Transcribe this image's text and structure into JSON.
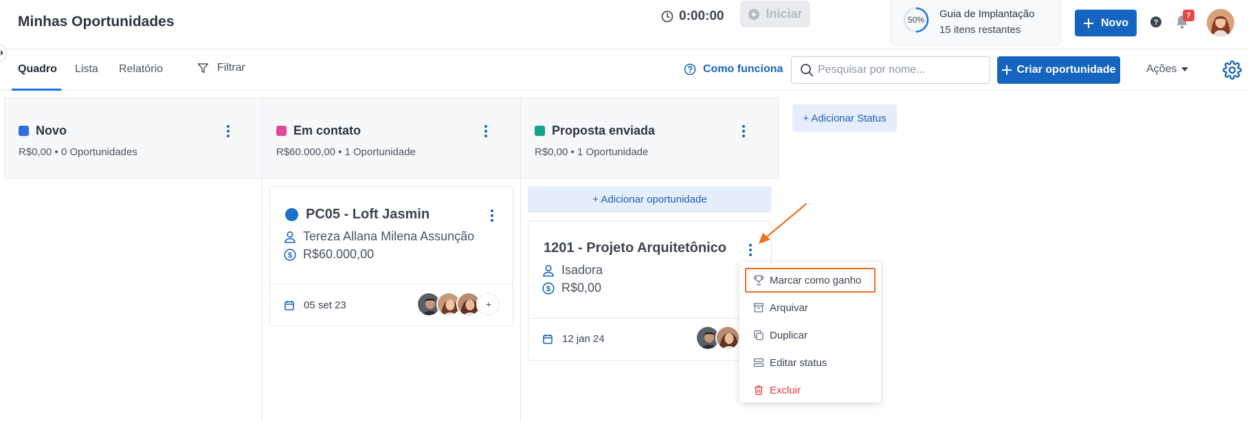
{
  "header": {
    "title": "Minhas Oportunidades",
    "timer": "0:00:00",
    "start_label": "Iniciar",
    "guide": {
      "progress_label": "50%",
      "progress": 0.5,
      "title": "Guia de Implantação",
      "subtitle": "15 itens restantes"
    },
    "new_label": "Novo",
    "notifications_count": "7"
  },
  "tabs": [
    "Quadro",
    "Lista",
    "Relatório"
  ],
  "toolbar": {
    "filter_label": "Filtrar",
    "how_label": "Como funciona",
    "search_placeholder": "Pesquisar por nome...",
    "create_label": "Criar oportunidade",
    "actions_label": "Ações"
  },
  "columns": [
    {
      "title": "Novo",
      "color": "#2f6fdb",
      "summary": "R$0,00 • 0 Oportunidades"
    },
    {
      "title": "Em contato",
      "color": "#e5489b",
      "summary": "R$60.000,00 • 1 Oportunidade"
    },
    {
      "title": "Proposta enviada",
      "color": "#14a38b",
      "summary": "R$0,00 • 1 Oportunidade"
    }
  ],
  "add_status_label": "+ Adicionar Status",
  "add_opportunity_label": "+ Adicionar oportunidade",
  "cards": [
    {
      "title": "PC05 - Loft Jasmin",
      "person": "Tereza Allana Milena Assunção",
      "value": "R$60.000,00",
      "date": "05 set 23",
      "more_label": "+"
    },
    {
      "title": "1201 - Projeto Arquitetônico",
      "person": "Isadora",
      "value": "R$0,00",
      "date": "12 jan 24"
    }
  ],
  "menu": [
    {
      "label": "Marcar como ganho",
      "icon": "trophy-icon"
    },
    {
      "label": "Arquivar",
      "icon": "archive-icon"
    },
    {
      "label": "Duplicar",
      "icon": "copy-icon"
    },
    {
      "label": "Editar status",
      "icon": "status-icon"
    },
    {
      "label": "Excluir",
      "icon": "trash-icon",
      "danger": true
    }
  ],
  "colors": {
    "primary": "#1565c0",
    "highlight": "#ef6c22",
    "danger": "#e53935"
  }
}
